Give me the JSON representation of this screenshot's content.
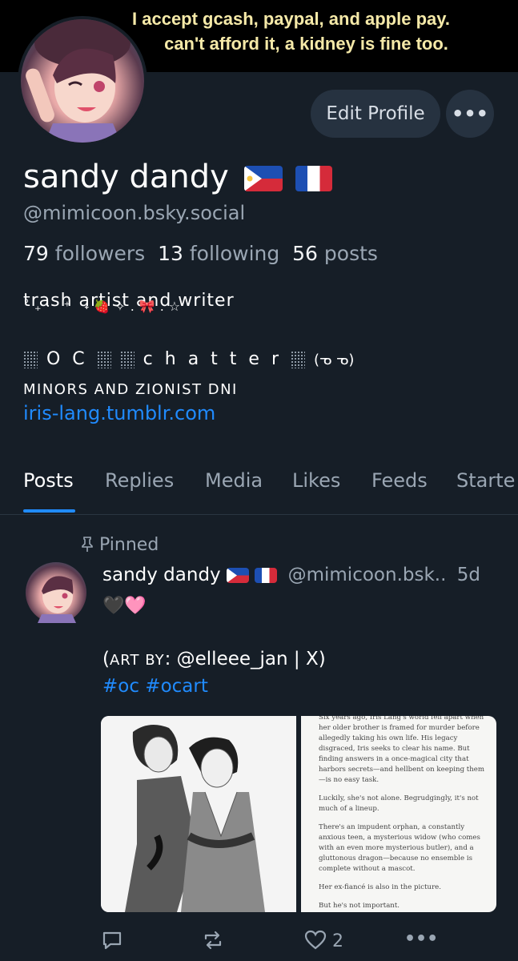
{
  "banner": {
    "line1": "I accept gcash, paypal, and apple pay.",
    "line2": "can't afford it, a kidney is fine too."
  },
  "profile": {
    "display_name": "sandy dandy",
    "handle": "@mimicoon.bsky.social",
    "edit_button": "Edit Profile",
    "more_button": "•••",
    "stats": {
      "followers_count": "79",
      "followers_label": "followers",
      "following_count": "13",
      "following_label": "following",
      "posts_count": "56",
      "posts_label": "posts"
    },
    "bio": {
      "line1": "trash artist and writer",
      "line1_decor": "˚₊‧ ⁺ ˖🍓✧.🎀.☆",
      "line2_word1": "O C",
      "line2_word2": "c h a t t e r",
      "line2_kaomoji": "(ᓀ ᓀ)",
      "line3": "MINORS AND ZIONIST DNI",
      "link": "iris-lang.tumblr.com"
    }
  },
  "tabs": [
    "Posts",
    "Replies",
    "Media",
    "Likes",
    "Feeds",
    "Starte"
  ],
  "post": {
    "pinned_label": "Pinned",
    "author_name": "sandy dandy",
    "author_handle": "@mimicoon.bsk..",
    "time": "5d",
    "hearts": "🖤🩷",
    "text_open": "(",
    "text_smallcaps": "ART BY",
    "text_rest": ": @elleee_jan | X)",
    "tags": "#oc #ocart",
    "excerpt": [
      "Six years ago, Iris Lang's world fell apart when her older brother is framed for murder before allegedly taking his own life. His legacy disgraced, Iris seeks to clear his name. But finding answers in a once-magical city that harbors secrets—and hellbent on keeping them—is no easy task.",
      "Luckily, she's not alone. Begrudgingly, it's not much of a lineup.",
      "There's an impudent orphan, a constantly anxious teen, a mysterious widow (who comes with an even more mysterious butler), and a gluttonous dragon—because no ensemble is complete without a mascot.",
      "Her ex-fiancé is also in the picture.",
      "But he's not important."
    ],
    "like_count": "2"
  },
  "colors": {
    "background": "#161e27",
    "accent": "#208bfe",
    "muted": "#9aa6b3",
    "button_bg": "#263240"
  }
}
